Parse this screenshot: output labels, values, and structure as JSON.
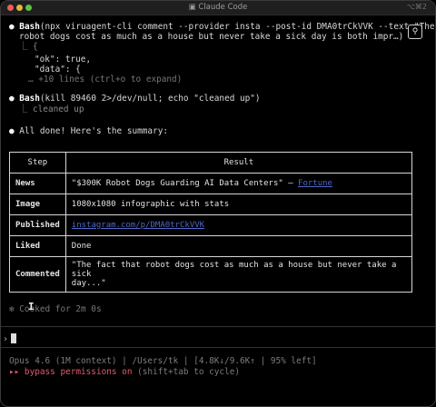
{
  "window": {
    "title": "Claude Code",
    "shortcut": "⌥⌘2"
  },
  "tool_icon": "terminal-icon",
  "blocks": {
    "cmd1_name": "Bash",
    "cmd1_arg1": "(npx viruagent-cli comment --provider insta --post-id DMA0trCkVVK --text \"The fact that",
    "cmd1_arg2": "robot dogs cost as much as a house but never take a sick day is both impr…)",
    "cmd1_out1": "⎿ {",
    "cmd1_out2": "\"ok\": true,",
    "cmd1_out3": "\"data\": {",
    "cmd1_more": "… +10 lines (ctrl+o to expand)",
    "cmd2_name": "Bash",
    "cmd2_arg": "(kill 89460 2>/dev/null; echo \"cleaned up\")",
    "cmd2_out": "⎿ cleaned up",
    "done_text": "All done! Here's the summary:"
  },
  "table": {
    "headers": [
      "Step",
      "Result"
    ],
    "rows": [
      {
        "step": "News",
        "result": "\"$300K Robot Dogs Guarding AI Data Centers\" — ",
        "link": "Fortune"
      },
      {
        "step": "Image",
        "result": "1080x1080 infographic with stats",
        "link": ""
      },
      {
        "step": "Published",
        "result": "",
        "link": "instagram.com/p/DMA0trCkVVK"
      },
      {
        "step": "Liked",
        "result": "Done",
        "link": ""
      },
      {
        "step": "Commented",
        "result": "\"The fact that robot dogs cost as much as a house but never take a sick",
        "result2": "day...\""
      }
    ]
  },
  "cooked": "✻ Cooked for 2m 0s",
  "prompt": {
    "caret": "›"
  },
  "status": {
    "line1": "Opus 4.6 (1M context) | /Users/tk | [4.8K↓/9.6K↑ | 95% left]",
    "bypass_strong": "▸▸ bypass permissions on",
    "bypass_rest": " (shift+tab to cycle)"
  },
  "colors": {
    "link": "#4d67c6",
    "bypass": "#e25b6e",
    "background": "#000000"
  }
}
